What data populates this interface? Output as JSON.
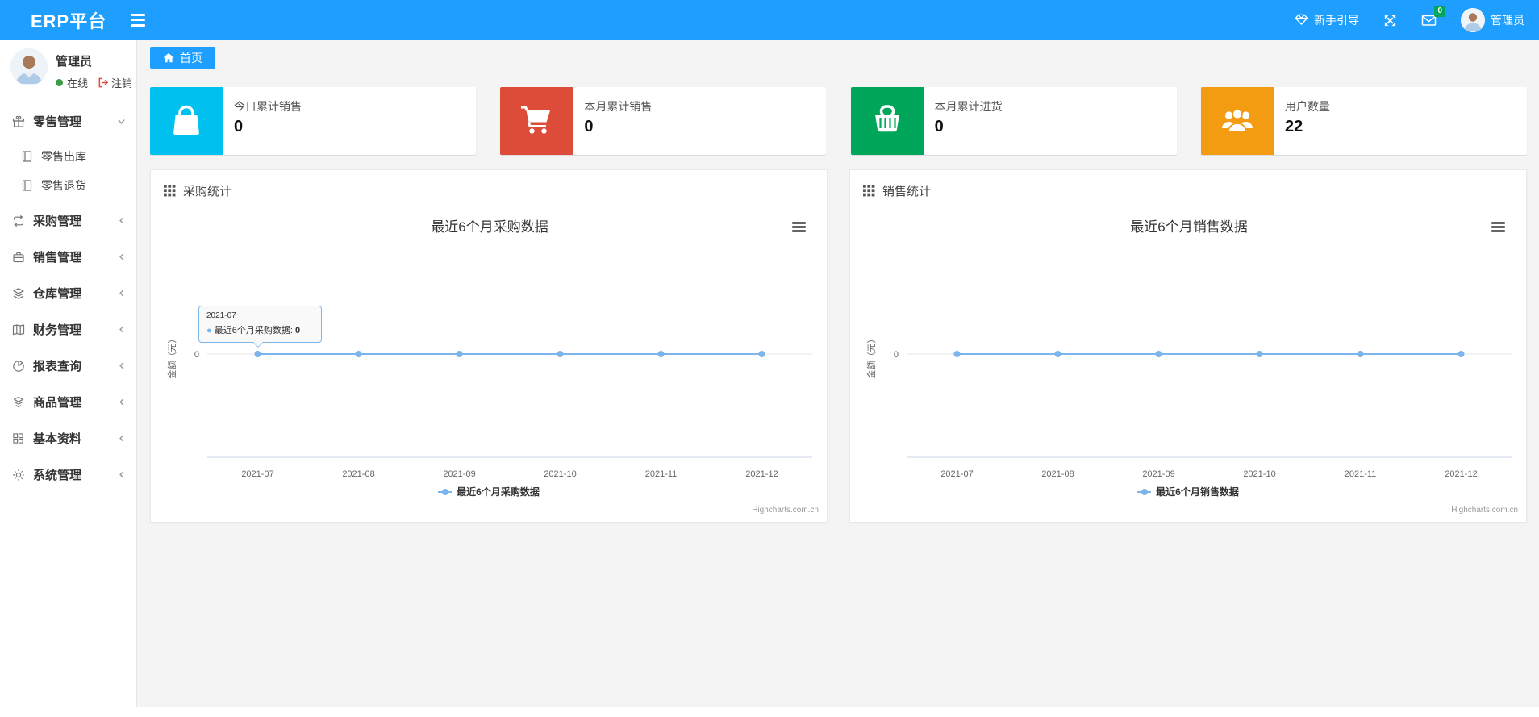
{
  "navbar": {
    "brand": "ERP平台",
    "guide_label": "新手引导",
    "mail_badge": "0",
    "username": "管理员"
  },
  "sidebar": {
    "user": {
      "name": "管理员",
      "status": "在线",
      "logout": "注销"
    },
    "menu": [
      {
        "label": "零售管理",
        "icon": "gift-icon",
        "state": "expanded",
        "children": [
          {
            "label": "零售出库"
          },
          {
            "label": "零售退货"
          }
        ]
      },
      {
        "label": "采购管理",
        "icon": "exchange-icon"
      },
      {
        "label": "销售管理",
        "icon": "briefcase-icon"
      },
      {
        "label": "仓库管理",
        "icon": "layers-icon"
      },
      {
        "label": "财务管理",
        "icon": "open-book-icon"
      },
      {
        "label": "报表查询",
        "icon": "pie-chart-icon"
      },
      {
        "label": "商品管理",
        "icon": "box-icon"
      },
      {
        "label": "基本资料",
        "icon": "grid-icon"
      },
      {
        "label": "系统管理",
        "icon": "gear-icon"
      }
    ]
  },
  "breadcrumb": {
    "home": "首页"
  },
  "cards": [
    {
      "label": "今日累计销售",
      "value": "0",
      "color": "#00c0ef",
      "icon": "shopping-bag-icon"
    },
    {
      "label": "本月累计销售",
      "value": "0",
      "color": "#dd4b39",
      "icon": "shopping-cart-icon"
    },
    {
      "label": "本月累计进货",
      "value": "0",
      "color": "#00a65a",
      "icon": "shopping-basket-icon"
    },
    {
      "label": "用户数量",
      "value": "22",
      "color": "#f39c12",
      "icon": "users-icon"
    }
  ],
  "panels": [
    {
      "header": "采购统计"
    },
    {
      "header": "销售统计"
    }
  ],
  "chart_data": [
    {
      "type": "line",
      "title": "最近6个月采购数据",
      "categories": [
        "2021-07",
        "2021-08",
        "2021-09",
        "2021-10",
        "2021-11",
        "2021-12"
      ],
      "series": [
        {
          "name": "最近6个月采购数据",
          "values": [
            0,
            0,
            0,
            0,
            0,
            0
          ]
        }
      ],
      "ylabel": "金额（元）",
      "ytick": "0",
      "ylim": [
        -1,
        1
      ],
      "color": "#7cb5ec",
      "legend_position": "bottom",
      "grid": true,
      "credits": "Highcharts.com.cn",
      "tooltip": {
        "header": "2021-07",
        "label": "最近6个月采购数据:",
        "value": "0"
      }
    },
    {
      "type": "line",
      "title": "最近6个月销售数据",
      "categories": [
        "2021-07",
        "2021-08",
        "2021-09",
        "2021-10",
        "2021-11",
        "2021-12"
      ],
      "series": [
        {
          "name": "最近6个月销售数据",
          "values": [
            0,
            0,
            0,
            0,
            0,
            0
          ]
        }
      ],
      "ylabel": "金额（元）",
      "ytick": "0",
      "ylim": [
        -1,
        1
      ],
      "color": "#7cb5ec",
      "legend_position": "bottom",
      "grid": true,
      "credits": "Highcharts.com.cn"
    }
  ],
  "colors": {
    "navbar": "#1e9fff",
    "series": "#7cb5ec",
    "badge": "#00a65a",
    "card_aqua": "#00c0ef",
    "card_red": "#dd4b39",
    "card_green": "#00a65a",
    "card_yellow": "#f39c12"
  }
}
